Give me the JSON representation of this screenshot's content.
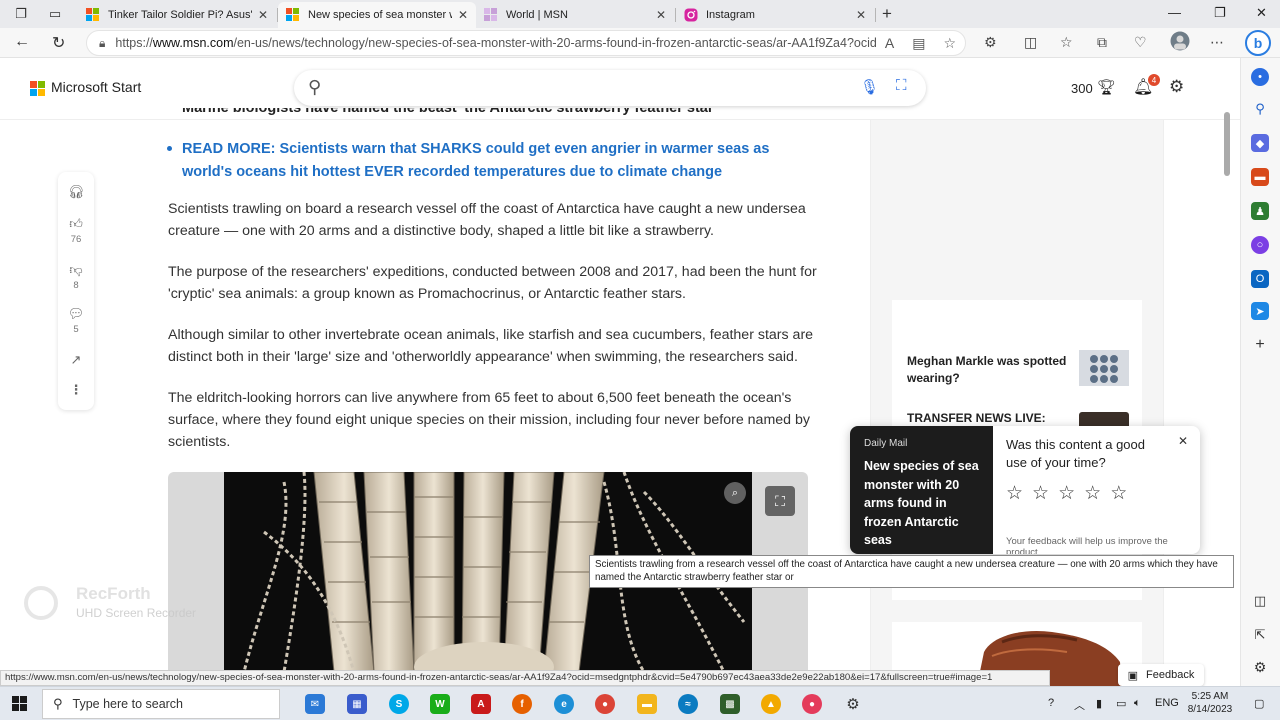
{
  "browser": {
    "tabs": [
      {
        "title": "Tinker Tailor Soldier Pi? Asus's 'N",
        "icon": "msn-icon",
        "color": "#e8403a"
      },
      {
        "title": "New species of sea monster with",
        "icon": "msn-icon",
        "color": "#e8403a"
      },
      {
        "title": "World | MSN",
        "icon": "msn-icon",
        "color": "#c7a0d8"
      },
      {
        "title": "Instagram",
        "icon": "instagram-icon",
        "color": "#d6249f"
      }
    ],
    "url_prefix": "https://",
    "url_host": "www.msn.com",
    "url_path": "/en-us/news/technology/new-species-of-sea-monster-with-20-arms-found-in-frozen-antarctic-seas/ar-AA1f9Za4?ocid=..."
  },
  "msn": {
    "brand": "Microsoft Start",
    "search_placeholder": "",
    "points": "300",
    "notification_count": "4"
  },
  "rail": {
    "like_count": "76",
    "dislike_count": "8",
    "comment_count": "5"
  },
  "article": {
    "cut_line": "Marine biologists have named the beast 'the Antarctic strawberry feather star'",
    "read_more": "READ MORE: Scientists warn that SHARKS could get even angrier in warmer seas as world's oceans hit hottest EVER recorded temperatures due to climate change",
    "paragraphs": [
      "Scientists trawling on board a research vessel off the coast of Antarctica have caught a new undersea creature — one with 20 arms and a distinctive body, shaped a little bit like a strawberry.",
      "The purpose of the researchers' expeditions, conducted between 2008 and 2017, had been the hunt for 'cryptic' sea animals: a group known as Promachocrinus, or Antarctic feather stars.",
      "Although similar to other invertebrate ocean animals, like starfish and sea cucumbers, feather stars are distinct both in their 'large' size and 'otherworldly appearance' when swimming, the researchers said.",
      "The eldritch-looking horrors can live anywhere from 65 feet to about 6,500 feet beneath the ocean's surface, where they found eight unique species on their mission, including four never before named by scientists."
    ]
  },
  "sidebar": {
    "news": [
      {
        "title": "Meghan Markle was spotted wearing?"
      },
      {
        "title": "TRANSFER NEWS LIVE:"
      }
    ]
  },
  "popup": {
    "source": "Daily Mail",
    "title": "New species of sea monster with 20 arms found in frozen Antarctic seas",
    "question": "Was this content a good use of your time?",
    "feedback_note": "Your feedback will help us improve the product"
  },
  "tooltip": "Scientists trawling from a research vessel off the coast of Antarctica have caught a new undersea creature — one with 20 arms which they have named the Antarctic strawberry feather star or",
  "watermark": {
    "title": "RecForth",
    "subtitle": "UHD Screen Recorder"
  },
  "status_url": "https://www.msn.com/en-us/news/technology/new-species-of-sea-monster-with-20-arms-found-in-frozen-antarctic-seas/ar-AA1f9Za4?ocid=msedgntphdr&cvid=5e4790b697ec43aea33de2e9e22ab180&ei=17&fullscreen=true#image=1",
  "feedback_label": "Feedback",
  "taskbar": {
    "search_placeholder": "Type here to search",
    "language": "ENG",
    "time": "5:25 AM",
    "date": "8/14/2023"
  }
}
